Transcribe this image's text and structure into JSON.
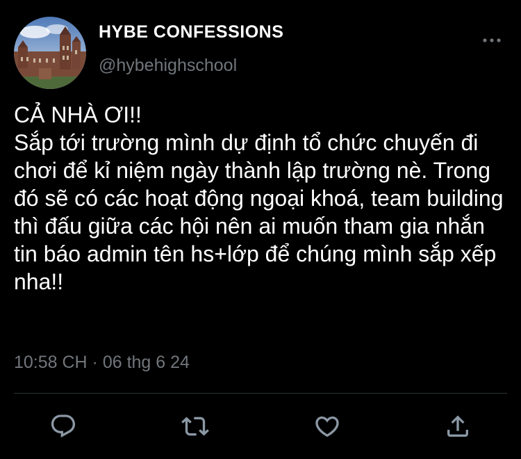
{
  "header": {
    "display_name": "HYBE CONFESSIONS",
    "handle": "@hybehighschool",
    "more_icon": "ellipsis-icon"
  },
  "tweet": {
    "text": "CẢ NHÀ ƠI!!\nSắp tới trường mình dự định tổ chức chuyến đi chơi để kỉ niệm ngày thành lập trường nè. Trong đó sẽ có các hoạt động ngoại khoá, team building thì đấu giữa các hội nên ai muốn tham gia nhắn tin báo admin tên hs+lớp để chúng mình sắp xếp nha!!",
    "timestamp": "10:58 CH · 06 thg 6 24"
  },
  "actions": [
    {
      "icon": "reply-icon"
    },
    {
      "icon": "retweet-icon"
    },
    {
      "icon": "like-icon"
    },
    {
      "icon": "share-icon"
    }
  ],
  "colors": {
    "background": "#000000",
    "text_primary": "#ffffff",
    "text_secondary": "#71767b",
    "divider": "#2f3336"
  }
}
